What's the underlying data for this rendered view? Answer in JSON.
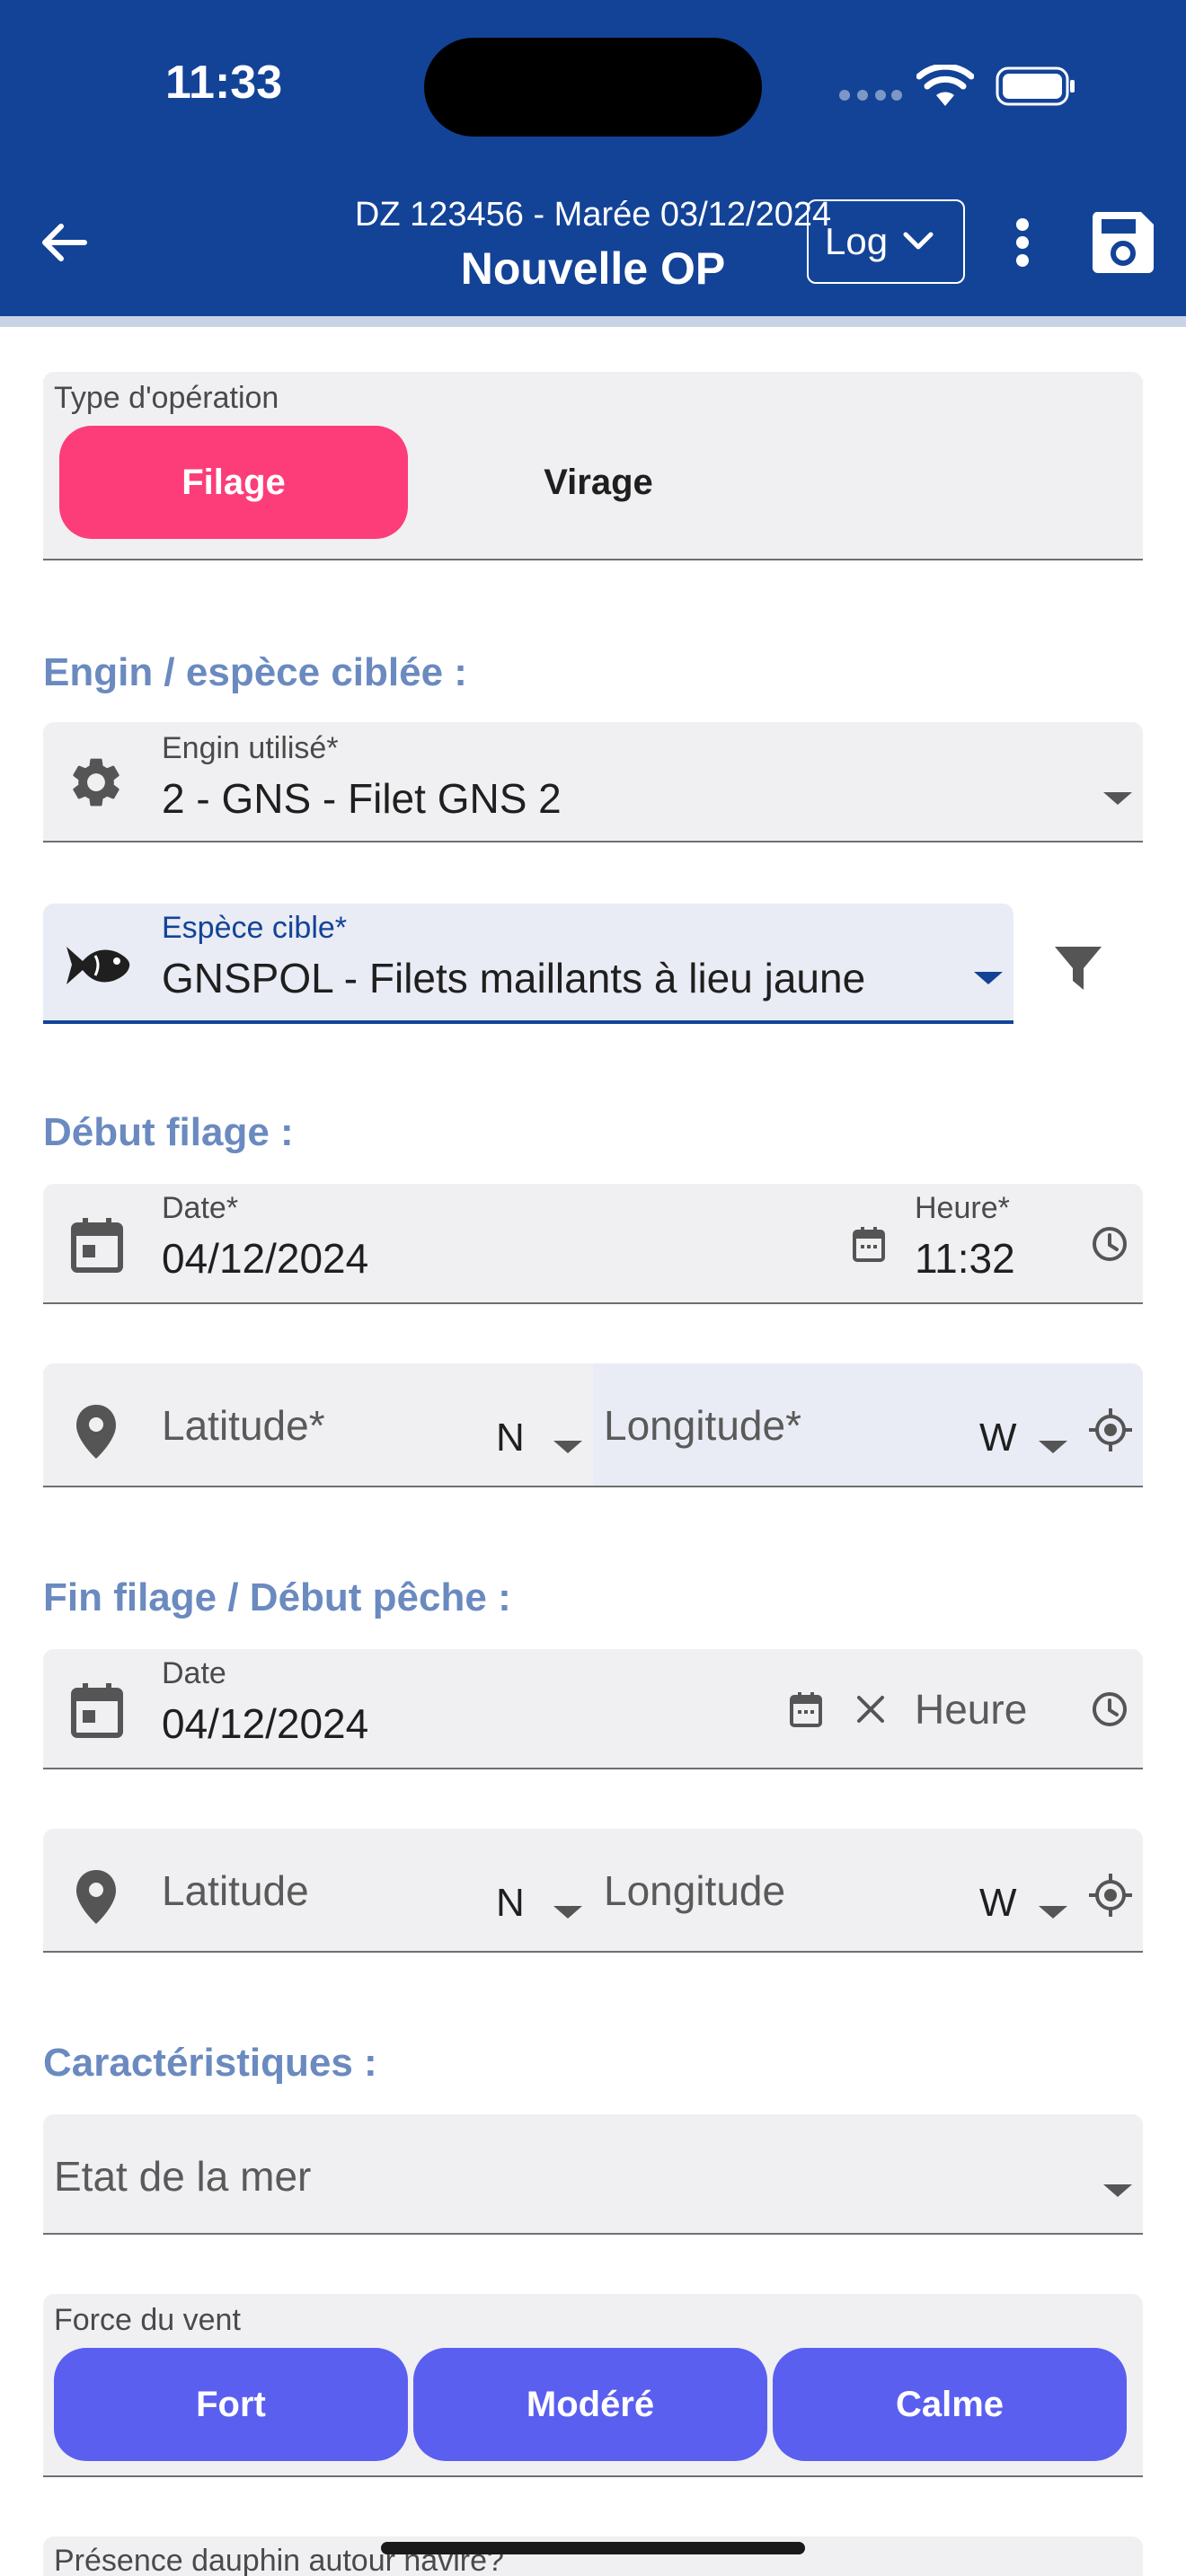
{
  "status_bar": {
    "time": "11:33"
  },
  "header": {
    "subtitle": "DZ 123456 - Marée 03/12/2024",
    "title": "Nouvelle OP",
    "log_label": "Log"
  },
  "operation_type": {
    "label": "Type d'opération",
    "options": [
      "Filage",
      "Virage"
    ],
    "selected": "Filage"
  },
  "section_engin": {
    "title": "Engin / espèce ciblée :",
    "engin_label": "Engin utilisé*",
    "engin_value": "2 - GNS - Filet GNS 2",
    "espece_label": "Espèce cible*",
    "espece_value": "GNSPOL - Filets maillants à lieu jaune"
  },
  "section_debut": {
    "title": "Début filage :",
    "date_label": "Date*",
    "date_value": "04/12/2024",
    "heure_label": "Heure*",
    "heure_value": "11:32",
    "latitude_placeholder": "Latitude*",
    "lat_hemisphere": "N",
    "longitude_placeholder": "Longitude*",
    "lon_hemisphere": "W"
  },
  "section_fin": {
    "title": "Fin filage / Début pêche :",
    "date_label": "Date",
    "date_value": "04/12/2024",
    "heure_placeholder": "Heure",
    "latitude_placeholder": "Latitude",
    "lat_hemisphere": "N",
    "longitude_placeholder": "Longitude",
    "lon_hemisphere": "W"
  },
  "section_caract": {
    "title": "Caractéristiques :",
    "etat_mer_placeholder": "Etat de la mer",
    "force_vent_label": "Force du vent",
    "force_vent_options": [
      "Fort",
      "Modéré",
      "Calme"
    ],
    "dauphin_label": "Présence dauphin autour navire?"
  },
  "colors": {
    "header": "#134397",
    "accent_pink": "#fc3d7a",
    "accent_blue": "#5a5ff0",
    "section_title": "#6a8ac0"
  }
}
